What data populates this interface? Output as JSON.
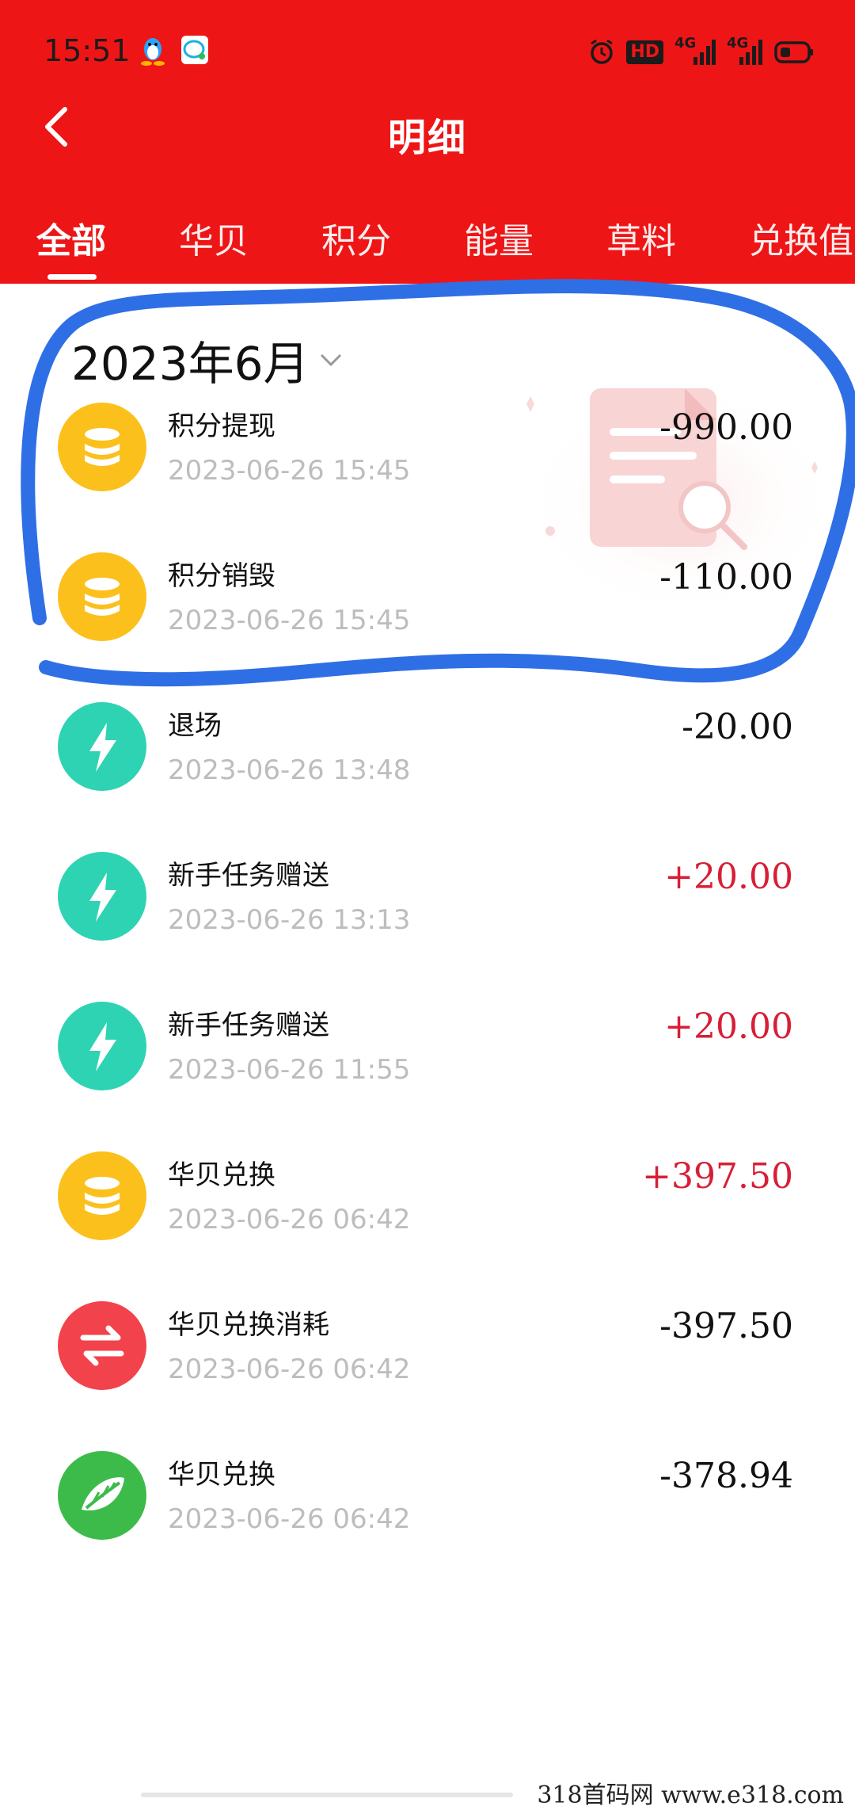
{
  "status_bar": {
    "time": "15:51",
    "left_icons": [
      "qq-penguin-icon",
      "chat-bubble-icon"
    ],
    "right_icons": [
      "alarm-icon",
      "hd-icon",
      "signal-4g-icon",
      "signal-4g-icon",
      "battery-icon"
    ],
    "hd_label": "HD",
    "net_label_1": "4G",
    "net_label_2": "4G"
  },
  "nav": {
    "title": "明细",
    "back_icon": "chevron-left-icon"
  },
  "tabs": [
    {
      "label": "全部",
      "active": true
    },
    {
      "label": "华贝",
      "active": false
    },
    {
      "label": "积分",
      "active": false
    },
    {
      "label": "能量",
      "active": false
    },
    {
      "label": "草料",
      "active": false
    },
    {
      "label": "兑换值",
      "active": false
    }
  ],
  "month_filter": {
    "label": "2023年6月",
    "icon": "chevron-down-icon"
  },
  "transactions": [
    {
      "title": "积分提现",
      "time": "2023-06-26 15:45",
      "amount": "-990.00",
      "icon": "coin-stack-icon",
      "icon_color": "#fcc01c",
      "positive": false
    },
    {
      "title": "积分销毁",
      "time": "2023-06-26 15:45",
      "amount": "-110.00",
      "icon": "coin-stack-icon",
      "icon_color": "#fcc01c",
      "positive": false
    },
    {
      "title": "退场",
      "time": "2023-06-26 13:48",
      "amount": "-20.00",
      "icon": "lightning-icon",
      "icon_color": "#2ed3b4",
      "positive": false
    },
    {
      "title": "新手任务赠送",
      "time": "2023-06-26 13:13",
      "amount": "+20.00",
      "icon": "lightning-icon",
      "icon_color": "#2ed3b4",
      "positive": true
    },
    {
      "title": "新手任务赠送",
      "time": "2023-06-26 11:55",
      "amount": "+20.00",
      "icon": "lightning-icon",
      "icon_color": "#2ed3b4",
      "positive": true
    },
    {
      "title": "华贝兑换",
      "time": "2023-06-26 06:42",
      "amount": "+397.50",
      "icon": "coin-stack-icon",
      "icon_color": "#fcc01c",
      "positive": true
    },
    {
      "title": "华贝兑换消耗",
      "time": "2023-06-26 06:42",
      "amount": "-397.50",
      "icon": "exchange-arrows-icon",
      "icon_color": "#f2424b",
      "positive": false
    },
    {
      "title": "华贝兑换",
      "time": "2023-06-26 06:42",
      "amount": "-378.94",
      "icon": "leaf-icon",
      "icon_color": "#3dbb4a",
      "positive": false
    }
  ],
  "colors": {
    "header_red": "#ee1516",
    "positive_amount": "#d81e36",
    "timestamp_gray": "#bdbdbd",
    "annotation_blue": "#2f6fe6"
  },
  "watermark": "318首码网  www.e318.com"
}
